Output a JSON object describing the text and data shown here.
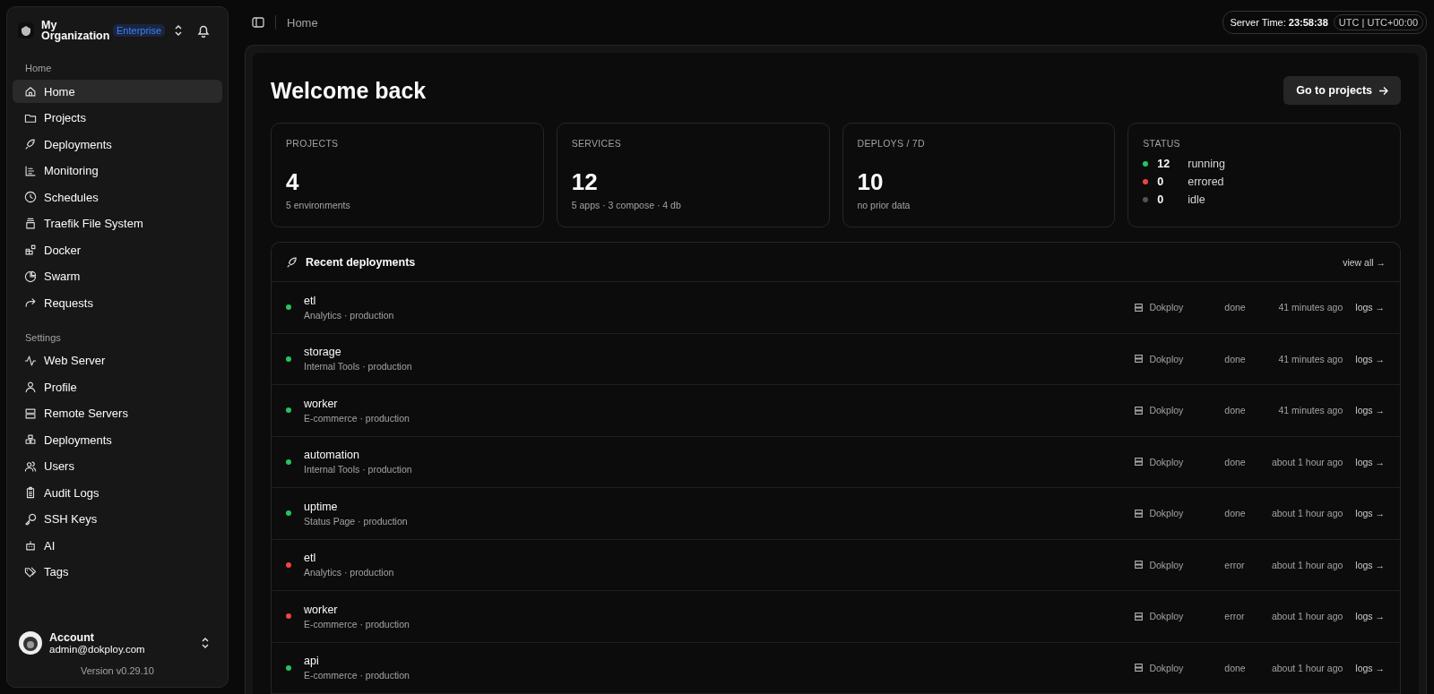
{
  "sidebar": {
    "organization": {
      "name": "My Organization",
      "plan": "Enterprise"
    },
    "sections": [
      {
        "title": "Home",
        "items": [
          {
            "label": "Home",
            "selected": true
          },
          {
            "label": "Projects",
            "selected": false
          },
          {
            "label": "Deployments",
            "selected": false
          },
          {
            "label": "Monitoring",
            "selected": false
          },
          {
            "label": "Schedules",
            "selected": false
          },
          {
            "label": "Traefik File System",
            "selected": false
          },
          {
            "label": "Docker",
            "selected": false
          },
          {
            "label": "Swarm",
            "selected": false
          },
          {
            "label": "Requests",
            "selected": false
          }
        ]
      },
      {
        "title": "Settings",
        "items": [
          {
            "label": "Web Server",
            "selected": false
          },
          {
            "label": "Profile",
            "selected": false
          },
          {
            "label": "Remote Servers",
            "selected": false
          },
          {
            "label": "Deployments",
            "selected": false
          },
          {
            "label": "Users",
            "selected": false
          },
          {
            "label": "Audit Logs",
            "selected": false
          },
          {
            "label": "SSH Keys",
            "selected": false
          },
          {
            "label": "AI",
            "selected": false
          },
          {
            "label": "Tags",
            "selected": false
          }
        ]
      }
    ],
    "account": {
      "name": "Account",
      "email": "admin@dokploy.com"
    },
    "version": "Version v0.29.10"
  },
  "topbar": {
    "breadcrumb": "Home",
    "server_time_label": "Server Time:",
    "server_time": "23:58:38",
    "timezone": "UTC | UTC+00:00"
  },
  "page": {
    "title": "Welcome back",
    "action": "Go to projects"
  },
  "stats": [
    {
      "label": "PROJECTS",
      "value": "4",
      "detail": "5 environments"
    },
    {
      "label": "SERVICES",
      "value": "12",
      "detail": "5 apps · 3 compose · 4 db"
    },
    {
      "label": "DEPLOYS / 7D",
      "value": "10",
      "detail": "no prior data"
    }
  ],
  "status": {
    "label": "STATUS",
    "items": [
      {
        "count": "12",
        "label": "running",
        "color": "#22c55e"
      },
      {
        "count": "0",
        "label": "errored",
        "color": "#ef4444"
      },
      {
        "count": "0",
        "label": "idle",
        "color": "#52525b"
      }
    ]
  },
  "recent": {
    "title": "Recent deployments",
    "view_all": "view all →",
    "rows": [
      {
        "name": "etl",
        "project": "Analytics · production",
        "server": "Dokploy",
        "status": "done",
        "time": "41 minutes ago",
        "link": "logs →",
        "color": "#22c55e"
      },
      {
        "name": "storage",
        "project": "Internal Tools · production",
        "server": "Dokploy",
        "status": "done",
        "time": "41 minutes ago",
        "link": "logs →",
        "color": "#22c55e"
      },
      {
        "name": "worker",
        "project": "E-commerce · production",
        "server": "Dokploy",
        "status": "done",
        "time": "41 minutes ago",
        "link": "logs →",
        "color": "#22c55e"
      },
      {
        "name": "automation",
        "project": "Internal Tools · production",
        "server": "Dokploy",
        "status": "done",
        "time": "about 1 hour ago",
        "link": "logs →",
        "color": "#22c55e"
      },
      {
        "name": "uptime",
        "project": "Status Page · production",
        "server": "Dokploy",
        "status": "done",
        "time": "about 1 hour ago",
        "link": "logs →",
        "color": "#22c55e"
      },
      {
        "name": "etl",
        "project": "Analytics · production",
        "server": "Dokploy",
        "status": "error",
        "time": "about 1 hour ago",
        "link": "logs →",
        "color": "#ef4444"
      },
      {
        "name": "worker",
        "project": "E-commerce · production",
        "server": "Dokploy",
        "status": "error",
        "time": "about 1 hour ago",
        "link": "logs →",
        "color": "#ef4444"
      },
      {
        "name": "api",
        "project": "E-commerce · production",
        "server": "Dokploy",
        "status": "done",
        "time": "about 1 hour ago",
        "link": "logs →",
        "color": "#22c55e"
      }
    ]
  }
}
